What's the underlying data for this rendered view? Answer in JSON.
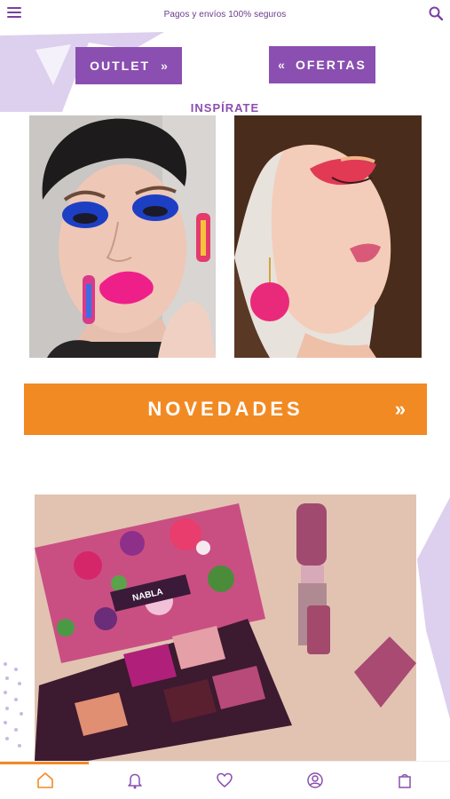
{
  "topbar": {
    "notice": "Pagos y envíos 100% seguros",
    "menu_icon": "hamburger-menu-icon",
    "search_icon": "search-icon"
  },
  "buttons": {
    "outlet_label": "OUTLET",
    "outlet_chevron": "»",
    "ofertas_label": "OFERTAS",
    "ofertas_chevron": "«",
    "novedades_label": "NOVEDADES",
    "novedades_chevron": "»"
  },
  "section": {
    "inspirate_title": "INSPÍRATE"
  },
  "images": {
    "look1": "portrait-blue-eyeshadow-pink-lips",
    "look2": "profile-pink-eyeshadow",
    "product": "nabla-palette-and-lipstick",
    "palette_brand": "NABLA"
  },
  "tabbar": {
    "items": [
      "home-icon",
      "bell-icon",
      "heart-icon",
      "user-icon",
      "bag-icon"
    ]
  },
  "colors": {
    "purple": "#8a4fb0",
    "orange": "#f28a24",
    "lilac": "#d9c8ec"
  }
}
